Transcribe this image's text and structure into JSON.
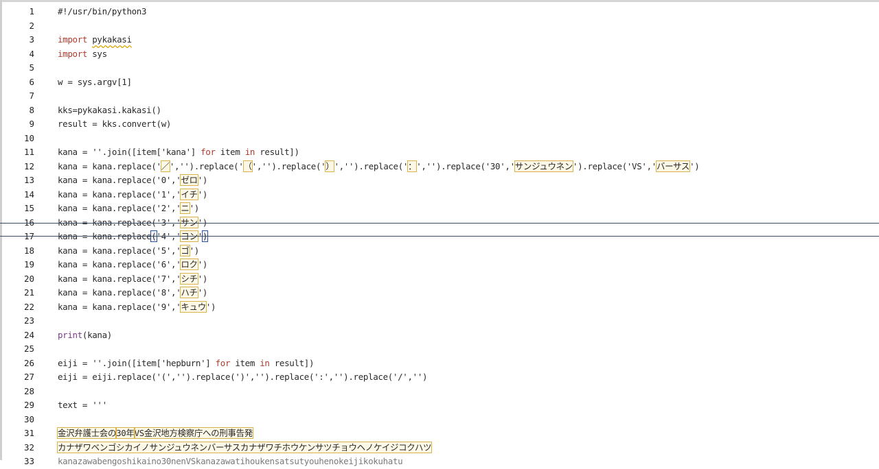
{
  "editor": {
    "lines": [
      {
        "n": "1",
        "t": "#!/usr/bin/python3"
      },
      {
        "n": "2",
        "t": ""
      },
      {
        "n": "3",
        "parts": [
          {
            "c": "kw",
            "t": "import"
          },
          {
            "t": " "
          },
          {
            "c": "wavy",
            "t": "pykakasi"
          }
        ]
      },
      {
        "n": "4",
        "parts": [
          {
            "c": "kw",
            "t": "import"
          },
          {
            "t": " sys"
          }
        ]
      },
      {
        "n": "5",
        "t": ""
      },
      {
        "n": "6",
        "t": "w = sys.argv[1]"
      },
      {
        "n": "7",
        "t": ""
      },
      {
        "n": "8",
        "t": "kks=pykakasi.kakasi()"
      },
      {
        "n": "9",
        "t": "result = kks.convert(w)"
      },
      {
        "n": "10",
        "t": ""
      },
      {
        "n": "11",
        "parts": [
          {
            "t": "kana = ''.join([item['kana'] "
          },
          {
            "c": "kw",
            "t": "for"
          },
          {
            "t": " item "
          },
          {
            "c": "kw",
            "t": "in"
          },
          {
            "t": " result])"
          }
        ]
      },
      {
        "n": "12",
        "parts": [
          {
            "t": "kana = kana.replace('"
          },
          {
            "c": "box",
            "t": "／"
          },
          {
            "t": "','').replace('"
          },
          {
            "c": "box",
            "t": "（"
          },
          {
            "t": "','').replace('"
          },
          {
            "c": "box",
            "t": "）"
          },
          {
            "t": "','').replace('"
          },
          {
            "c": "box",
            "t": "："
          },
          {
            "t": "','').replace('30','"
          },
          {
            "c": "box",
            "t": "サンジュウネン"
          },
          {
            "t": "').replace('VS','"
          },
          {
            "c": "box",
            "t": "バーサス"
          },
          {
            "t": "')"
          }
        ]
      },
      {
        "n": "13",
        "parts": [
          {
            "t": "kana = kana.replace('0','"
          },
          {
            "c": "box",
            "t": "ゼロ"
          },
          {
            "t": "')"
          }
        ]
      },
      {
        "n": "14",
        "parts": [
          {
            "t": "kana = kana.replace('1','"
          },
          {
            "c": "box",
            "t": "イチ"
          },
          {
            "t": "')"
          }
        ]
      },
      {
        "n": "15",
        "parts": [
          {
            "t": "kana = kana.replace('2','"
          },
          {
            "c": "box",
            "t": "ニ"
          },
          {
            "t": "')"
          }
        ]
      },
      {
        "n": "16",
        "parts": [
          {
            "t": "kana = kana.replace('3','"
          },
          {
            "c": "box",
            "t": "サン"
          },
          {
            "t": "')"
          }
        ]
      },
      {
        "n": "17",
        "parts": [
          {
            "t": "kana = kana.replace"
          },
          {
            "c": "box blue",
            "t": "("
          },
          {
            "t": "'4','"
          },
          {
            "c": "box",
            "t": "ヨン"
          },
          {
            "t": "'"
          },
          {
            "c": "box blue",
            "t": ")"
          }
        ]
      },
      {
        "n": "18",
        "parts": [
          {
            "t": "kana = kana.replace('5','"
          },
          {
            "c": "box",
            "t": "ゴ"
          },
          {
            "t": "')"
          }
        ]
      },
      {
        "n": "19",
        "parts": [
          {
            "t": "kana = kana.replace('6','"
          },
          {
            "c": "box",
            "t": "ロク"
          },
          {
            "t": "')"
          }
        ]
      },
      {
        "n": "20",
        "parts": [
          {
            "t": "kana = kana.replace('7','"
          },
          {
            "c": "box",
            "t": "シチ"
          },
          {
            "t": "')"
          }
        ]
      },
      {
        "n": "21",
        "parts": [
          {
            "t": "kana = kana.replace('8','"
          },
          {
            "c": "box",
            "t": "ハチ"
          },
          {
            "t": "')"
          }
        ]
      },
      {
        "n": "22",
        "parts": [
          {
            "t": "kana = kana.replace('9','"
          },
          {
            "c": "box",
            "t": "キュウ"
          },
          {
            "t": "')"
          }
        ]
      },
      {
        "n": "23",
        "t": ""
      },
      {
        "n": "24",
        "parts": [
          {
            "c": "fn",
            "t": "print"
          },
          {
            "t": "(kana)"
          }
        ]
      },
      {
        "n": "25",
        "t": ""
      },
      {
        "n": "26",
        "parts": [
          {
            "t": "eiji = ''.join([item['hepburn'] "
          },
          {
            "c": "kw",
            "t": "for"
          },
          {
            "t": " item "
          },
          {
            "c": "kw",
            "t": "in"
          },
          {
            "t": " result])"
          }
        ]
      },
      {
        "n": "27",
        "t": "eiji = eiji.replace('(','').replace(')','').replace(':','').replace('/','')"
      },
      {
        "n": "28",
        "t": ""
      },
      {
        "n": "29",
        "t": "text = '''"
      },
      {
        "n": "30",
        "t": ""
      },
      {
        "n": "31",
        "parts": [
          {
            "c": "box",
            "t": "金沢弁護士会の"
          },
          {
            "c": "box",
            "t": "30年"
          },
          {
            "c": "box",
            "t": "VS金沢地方検察庁への刑事告発"
          }
        ]
      },
      {
        "n": "32",
        "parts": [
          {
            "c": "box",
            "t": "カナザワベンゴシカイノサンジュウネンバーサスカナザワチホウケンサツチョウヘノケイジコクハツ"
          }
        ]
      },
      {
        "n": "33",
        "parts": [
          {
            "c": "clip",
            "t": "kanazawabengoshikaino30nenVSkanazawatihoukensatsutyouhenokeijikokuhatu"
          }
        ]
      }
    ]
  }
}
